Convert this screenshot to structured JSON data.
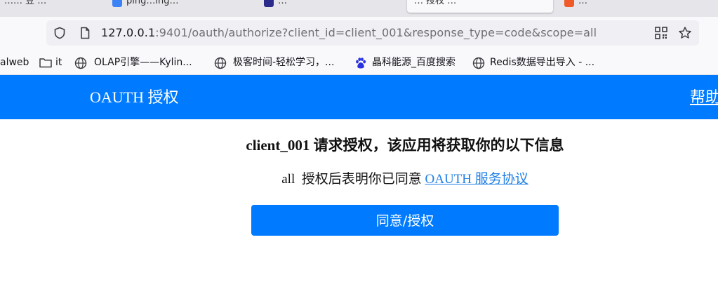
{
  "browser": {
    "tabs": [
      {
        "label": "…… 豆 …"
      },
      {
        "label": "ping…ing…"
      },
      {
        "label": "…"
      },
      {
        "label": "…"
      }
    ],
    "active_tab": {
      "label": "… 授权 …"
    },
    "address_bar": {
      "host": "127.0.0.1",
      "path": ":9401/oauth/authorize?client_id=client_001&response_type=code&scope=all"
    },
    "bookmarks": [
      {
        "label": "alweb",
        "icon": "none"
      },
      {
        "label": "it",
        "icon": "folder-icon"
      },
      {
        "label": "OLAP引擎——Kylin...",
        "icon": "globe-icon"
      },
      {
        "label": "极客时间-轻松学习，...",
        "icon": "globe-icon"
      },
      {
        "label": "晶科能源_百度搜索",
        "icon": "baidu-paw-icon"
      },
      {
        "label": "Redis数据导出导入 - ...",
        "icon": "globe-icon"
      }
    ]
  },
  "page": {
    "brand": "OAUTH 授权",
    "help_link": "帮助",
    "heading": "client_001 请求授权，该应用将获取你的以下信息",
    "scope": "all",
    "consent_text": "授权后表明你已同意",
    "agreement_link": "OAUTH 服务协议",
    "approve_button": "同意/授权",
    "colors": {
      "primary": "#007bff",
      "link": "#1f7fe6"
    }
  }
}
